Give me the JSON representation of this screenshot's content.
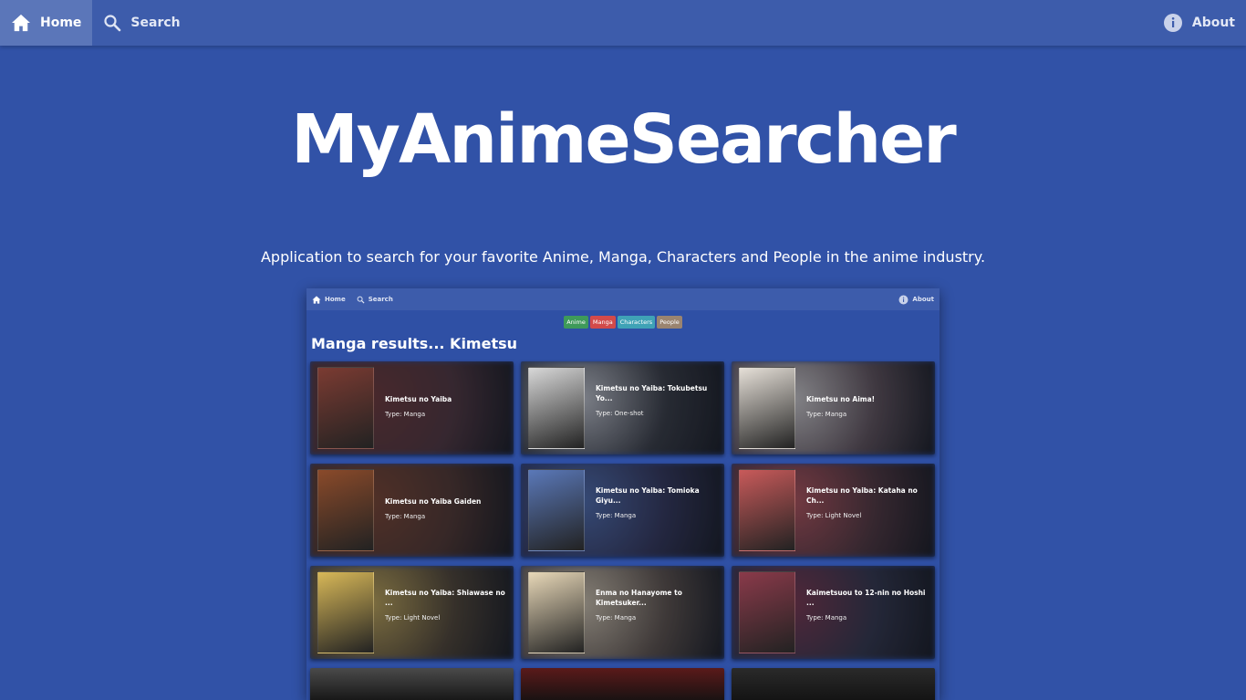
{
  "nav": {
    "home_label": "Home",
    "search_label": "Search",
    "about_label": "About"
  },
  "hero": {
    "logo_text": "MyAnimeSearcher",
    "subtitle": "Application to search for your favorite Anime, Manga, Characters and People in the anime industry."
  },
  "preview": {
    "nav": {
      "home_label": "Home",
      "search_label": "Search",
      "about_label": "About"
    },
    "tabs": [
      {
        "label": "Anime",
        "color": "#3e9a5a"
      },
      {
        "label": "Manga",
        "color": "#d24a4a"
      },
      {
        "label": "Characters",
        "color": "#3fa2b6"
      },
      {
        "label": "People",
        "color": "#9a8470"
      }
    ],
    "heading": "Manga results... Kimetsu",
    "cards": [
      {
        "title": "Kimetsu no Yaiba",
        "type": "Type: Manga",
        "bg": "#5a3a3a",
        "cover": "#7b3b32"
      },
      {
        "title": "Kimetsu no Yaiba: Tokubetsu Yo...",
        "type": "Type: One-shot",
        "bg": "#404040",
        "cover": "#d8d8d8"
      },
      {
        "title": "Kimetsu no Aima!",
        "type": "Type: Manga",
        "bg": "#6b5858",
        "cover": "#e6e0d8"
      },
      {
        "title": "Kimetsu no Yaiba Gaiden",
        "type": "Type: Manga",
        "bg": "#5a3a2a",
        "cover": "#8a4a2a"
      },
      {
        "title": "Kimetsu no Yaiba: Tomioka Giyu...",
        "type": "Type: Manga",
        "bg": "#3a3a5a",
        "cover": "#5a78b8"
      },
      {
        "title": "Kimetsu no Yaiba: Kataha no Ch...",
        "type": "Type: Light Novel",
        "bg": "#5a3a3a",
        "cover": "#c85a5a"
      },
      {
        "title": "Kimetsu no Yaiba: Shiawase no ...",
        "type": "Type: Light Novel",
        "bg": "#5a4a30",
        "cover": "#d8b858"
      },
      {
        "title": "Enma no Hanayome to Kimetsuker...",
        "type": "Type: Manga",
        "bg": "#6a5a4a",
        "cover": "#e8d8b8"
      },
      {
        "title": "Kaimetsuou to 12-nin no Hoshi ...",
        "type": "Type: Manga",
        "bg": "#3a3a4a",
        "cover": "#8a3a4a"
      }
    ],
    "partial_cards": [
      {
        "bg": "#4a4a4a"
      },
      {
        "bg": "#5a1a1a"
      },
      {
        "bg": "#2a2a2a"
      }
    ]
  }
}
